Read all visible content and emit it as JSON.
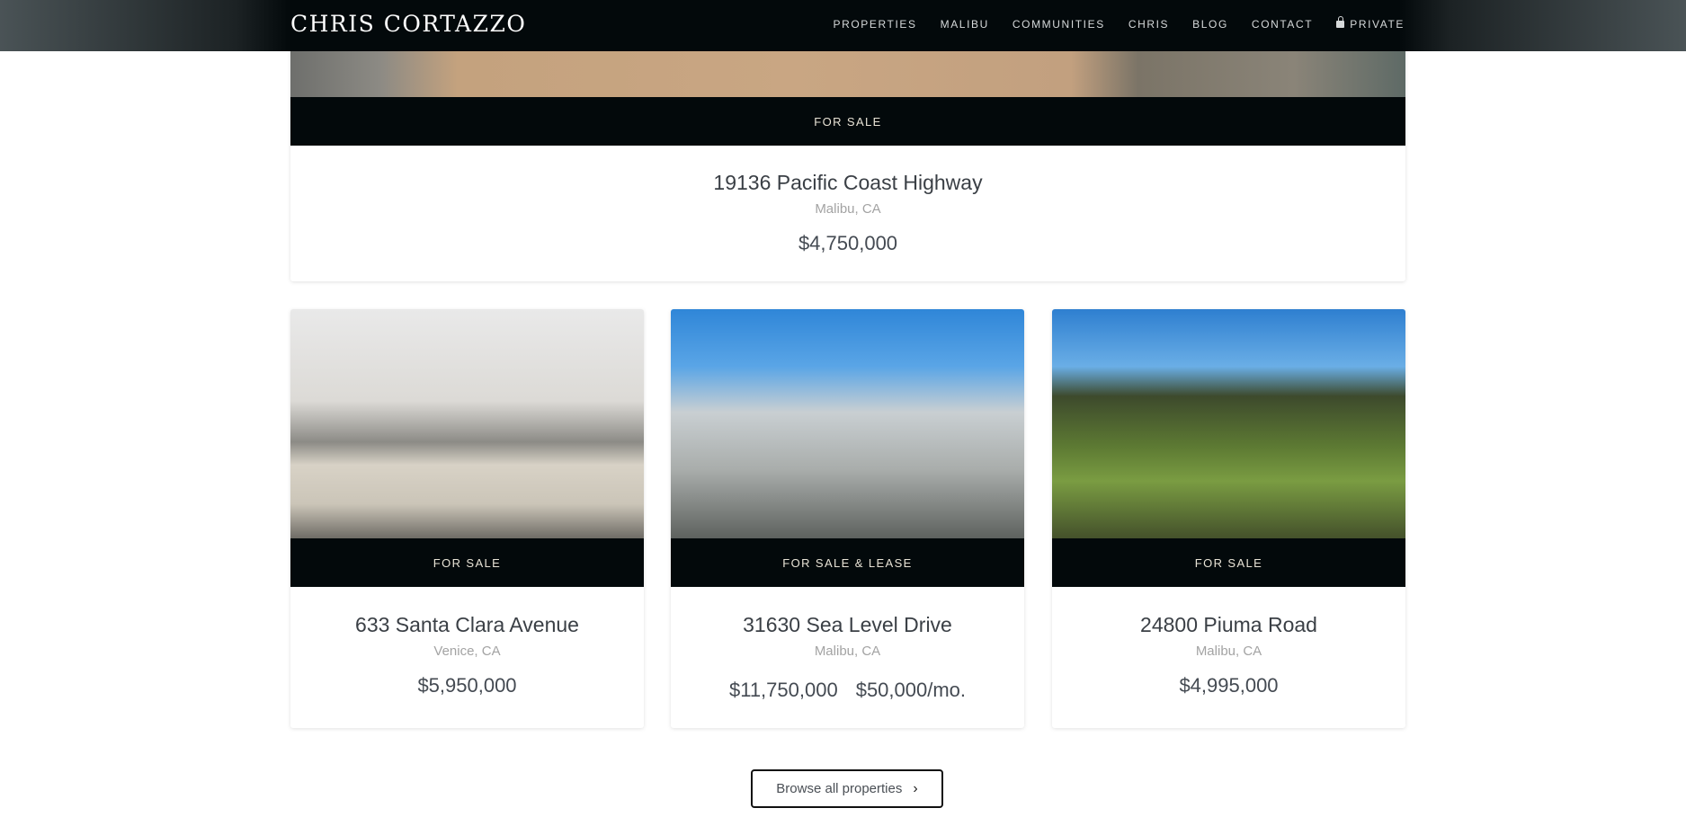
{
  "nav": {
    "logo": "CHRIS CORTAZZO",
    "items": [
      "PROPERTIES",
      "MALIBU",
      "COMMUNITIES",
      "CHRIS",
      "BLOG",
      "CONTACT",
      "PRIVATE"
    ]
  },
  "featured": {
    "status": "FOR SALE",
    "title": "19136 Pacific Coast Highway",
    "location": "Malibu, CA",
    "price": "$4,750,000"
  },
  "listings": [
    {
      "status": "FOR SALE",
      "title": "633 Santa Clara Avenue",
      "location": "Venice, CA",
      "prices": [
        "$5,950,000"
      ]
    },
    {
      "status": "FOR SALE & LEASE",
      "title": "31630 Sea Level Drive",
      "location": "Malibu, CA",
      "prices": [
        "$11,750,000",
        "$50,000/mo."
      ]
    },
    {
      "status": "FOR SALE",
      "title": "24800 Piuma Road",
      "location": "Malibu, CA",
      "prices": [
        "$4,995,000"
      ]
    }
  ],
  "browse": {
    "label": "Browse all properties",
    "icon": "chevron-right-icon"
  }
}
